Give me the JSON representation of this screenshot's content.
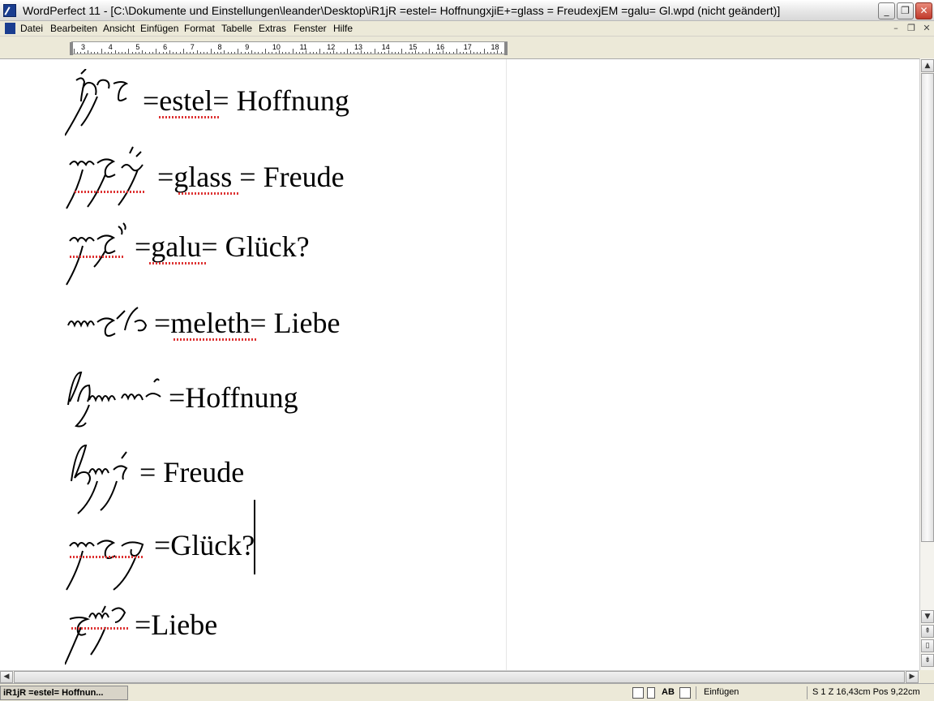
{
  "window": {
    "title": "WordPerfect 11 - [C:\\Dokumente und Einstellungen\\leander\\Desktop\\iR1jR =estel= HoffnungxjiE+=glass = FreudexjEM =galu= Gl.wpd (nicht geändert)]",
    "minimize": "_",
    "restore": "❐",
    "close": "✕"
  },
  "menu": {
    "items": [
      "Datei",
      "Bearbeiten",
      "Ansicht",
      "Einfügen",
      "Format",
      "Tabelle",
      "Extras",
      "Fenster",
      "Hilfe"
    ],
    "doc_minimize": "–",
    "doc_restore": "❐",
    "doc_close": "✕"
  },
  "ruler": {
    "numbers": [
      "3",
      "4",
      "5",
      "6",
      "7",
      "8",
      "9",
      "10",
      "11",
      "12",
      "13",
      "14",
      "15",
      "16",
      "17",
      "18"
    ]
  },
  "document": {
    "lines": [
      {
        "text": "=estel= Hoffnung"
      },
      {
        "text": "=glass = Freude"
      },
      {
        "text": "=galu= Glück?"
      },
      {
        "text": "=meleth= Liebe"
      },
      {
        "text": "=Hoffnung"
      },
      {
        "text": "= Freude"
      },
      {
        "text": "=Glück?"
      },
      {
        "text": "=Liebe"
      }
    ]
  },
  "scrollbar": {
    "up": "▲",
    "down": "▼",
    "prev_page": "⇞",
    "page": "▯",
    "next_page": "⇟",
    "left": "◀",
    "right": "▶"
  },
  "status": {
    "task_tab": "iR1jR =estel= Hoffnun...",
    "ab_label": "AB",
    "mode": "Einfügen",
    "position": "S 1 Z 16,43cm Pos 9,22cm"
  }
}
